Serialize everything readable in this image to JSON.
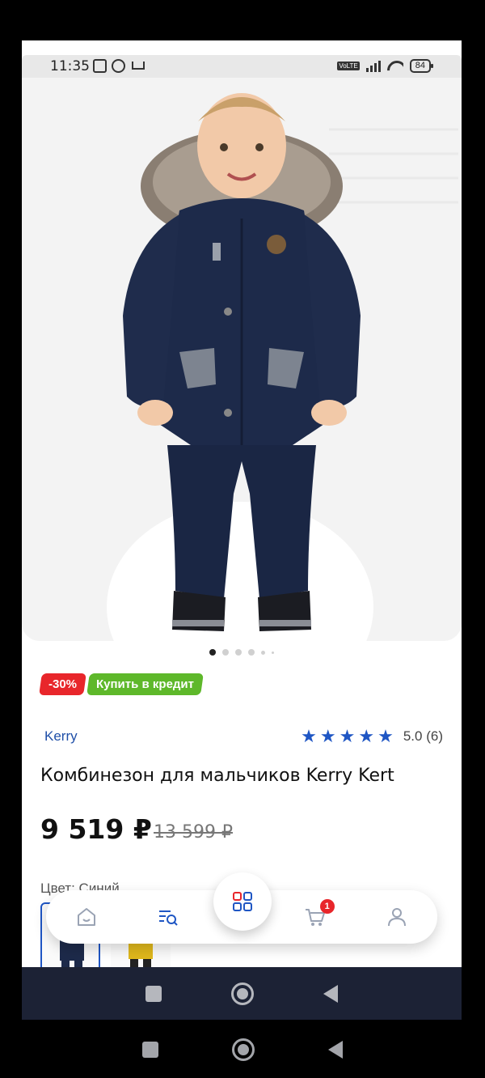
{
  "status_bar": {
    "time": "11:35",
    "battery": "84",
    "network": "VoLTE"
  },
  "product": {
    "image_alt": "Комбинезон",
    "discount_badge": "-30%",
    "credit_badge": "Купить в кредит",
    "brand": "Kerry",
    "rating": {
      "stars": 5,
      "value": "5.0",
      "count": "(6)"
    },
    "title": "Комбинезон для мальчиков Kerry Kert",
    "price": "9 519 ₽",
    "old_price": "13 599 ₽",
    "color_label": "Цвет: Синий"
  },
  "carousel": {
    "total_dots": 6,
    "active_index": 0
  },
  "bottom_nav": {
    "items": [
      "home-icon",
      "search-catalog-icon",
      "catalog-grid-icon",
      "cart-icon",
      "profile-icon"
    ],
    "cart_count": "1"
  },
  "colors": {
    "accent": "#1f56c4",
    "sale": "#e8262b",
    "credit": "#5eb82a"
  }
}
